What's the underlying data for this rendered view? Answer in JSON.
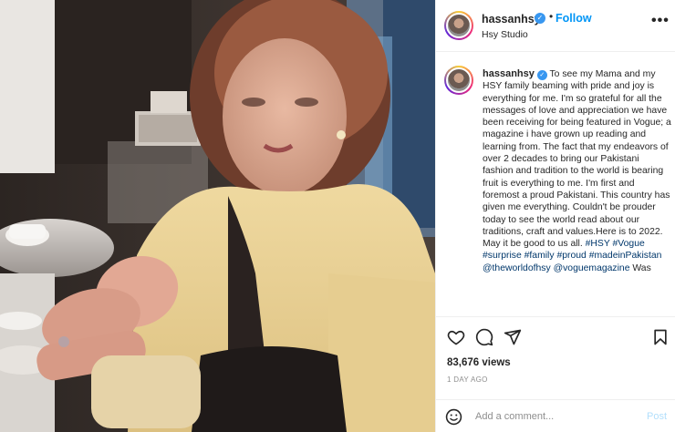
{
  "post": {
    "username": "hassanhsy",
    "location": "Hsy Studio",
    "follow_label": "Follow",
    "separator": "•",
    "more_label": "•••",
    "verified_glyph": "✓"
  },
  "caption": {
    "username": "hassanhsy",
    "text": "To see my Mama and my HSY family beaming with pride and joy is everything for me. I'm so grateful for all the messages of love and appreciation we have been receiving for being featured in Vogue; a magazine i have grown up reading and learning from. The fact that my endeavors of over 2 decades to bring our Pakistani fashion and tradition to the world is bearing fruit is everything to me. I'm first and foremost a proud Pakistani. This country has given me everything. Couldn't be prouder today to see the world read about our traditions, craft and values.Here is to 2022. May it be good to us all.",
    "hashtags": [
      "#HSY",
      "#Vogue",
      "#surprise",
      "#family",
      "#proud",
      "#madeinPakistan"
    ],
    "mentions": [
      "@theworldofhsy",
      "@voguemagazine"
    ],
    "trailing": "Was"
  },
  "actions": {
    "icons": [
      "heart-icon",
      "comment-icon",
      "share-icon",
      "bookmark-icon"
    ]
  },
  "engagement": {
    "likes": "83,676 views",
    "timestamp": "1 DAY AGO"
  },
  "comment": {
    "placeholder": "Add a comment...",
    "post_label": "Post"
  },
  "colors": {
    "accent": "#0095f6",
    "verified": "#3897f0",
    "link": "#00376b",
    "post_disabled": "#b2dffc"
  }
}
